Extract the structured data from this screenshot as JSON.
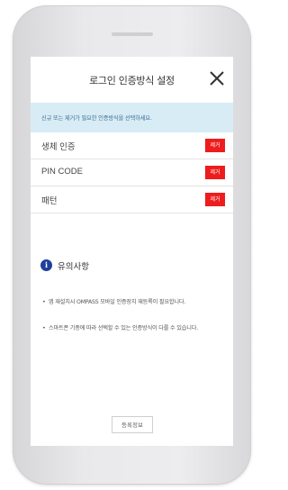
{
  "dialog": {
    "title": "로그인 인증방식 설정",
    "close_icon": "close-icon",
    "notice": "신규 또는 제거가 필요한 인증방식을 선택하세요."
  },
  "auth_methods": [
    {
      "label": "생체 인증",
      "action": "제거"
    },
    {
      "label": "PIN CODE",
      "action": "제거"
    },
    {
      "label": "패턴",
      "action": "제거"
    }
  ],
  "caution": {
    "icon": "info-icon",
    "icon_glyph": "i",
    "title": "유의사항",
    "items": [
      {
        "bullet": "•",
        "text": "앱 재설치시 OMPASS 모바일 인증장치 재등록이 필요합니다."
      },
      {
        "bullet": "•",
        "text": "스마트폰 기종에 따라 선택할 수 있는 인증방식이 다를 수 있습니다."
      }
    ]
  },
  "footer": {
    "register_label": "등록정보"
  },
  "colors": {
    "accent_red": "#ee1c1c",
    "notice_bg": "#d8ecf6",
    "info_icon": "#1f3f9c"
  }
}
